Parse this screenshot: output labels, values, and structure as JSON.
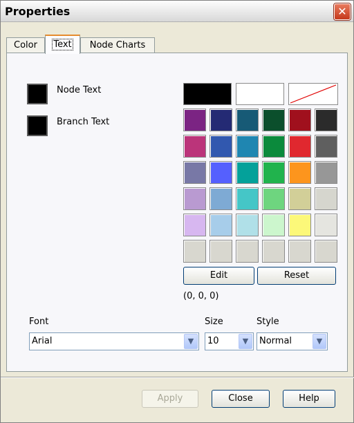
{
  "window": {
    "title": "Properties"
  },
  "tabs": [
    {
      "label": "Color"
    },
    {
      "label": "Text"
    },
    {
      "label": "Node Charts"
    }
  ],
  "text_settings": {
    "node_text_label": "Node Text",
    "branch_text_label": "Branch Text",
    "node_text_color": "#000000",
    "branch_text_color": "#000000"
  },
  "palette": {
    "top_row": [
      "#000000",
      "#ffffff",
      "none"
    ],
    "rows": [
      [
        "#7b2483",
        "#242a74",
        "#175a76",
        "#0b4f2c",
        "#a0101d",
        "#2b2b2b"
      ],
      [
        "#bb347a",
        "#3158af",
        "#1f86b1",
        "#0b8a3c",
        "#e0282f",
        "#5f5f5f"
      ],
      [
        "#7878a6",
        "#5560fe",
        "#04a19a",
        "#21b34d",
        "#fd951d",
        "#979797"
      ],
      [
        "#b99ad1",
        "#7eaad4",
        "#45c6c7",
        "#6ed57f",
        "#d2cf98",
        "#d6d6ce"
      ],
      [
        "#d7b7f0",
        "#a7cdea",
        "#b0e0e8",
        "#ccf6cd",
        "#fcf879",
        "#e5e5e0"
      ],
      [
        "#d8d7cf",
        "#d8d7cf",
        "#d8d7cf",
        "#d8d7cf",
        "#d8d7cf",
        "#d8d7cf"
      ]
    ]
  },
  "color_buttons": {
    "edit": "Edit",
    "reset": "Reset"
  },
  "rgb_readout": "(0, 0, 0)",
  "font": {
    "font_label": "Font",
    "size_label": "Size",
    "style_label": "Style",
    "font_value": "Arial",
    "size_value": "10",
    "style_value": "Normal"
  },
  "footer": {
    "apply": "Apply",
    "close": "Close",
    "help": "Help"
  }
}
